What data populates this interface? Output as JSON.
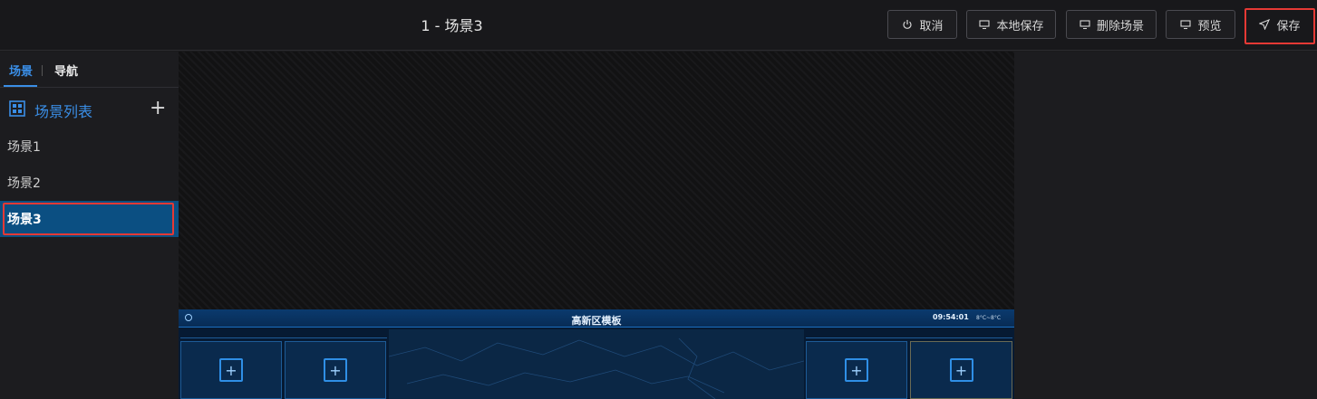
{
  "header": {
    "title": "1 - 场景3",
    "buttons": {
      "cancel": "取消",
      "local_save": "本地保存",
      "delete_scene": "删除场景",
      "preview": "预览",
      "save": "保存"
    }
  },
  "sidebar": {
    "tabs": [
      "场景",
      "导航"
    ],
    "list_title": "场景列表",
    "items": [
      "场景1",
      "场景2",
      "场景3"
    ],
    "active_index": 2
  },
  "preview": {
    "title": "高新区模板",
    "time": "09:54:01",
    "weather": "8°C~8°C"
  },
  "colors": {
    "accent": "#3a8ee6",
    "active_item": "#0b4f82",
    "highlight": "#e53935"
  }
}
